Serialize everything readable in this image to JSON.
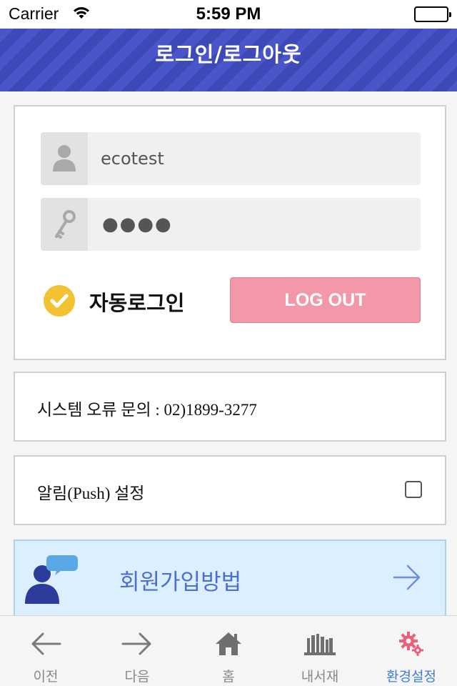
{
  "status_bar": {
    "carrier": "Carrier",
    "time": "5:59 PM"
  },
  "header": {
    "title": "로그인/로그아웃"
  },
  "login": {
    "username_value": "ecotest",
    "password_masked": "●●●●",
    "auto_login_label": "자동로그인",
    "auto_login_checked": true,
    "logout_label": "LOG OUT"
  },
  "contact": {
    "text": "시스템 오류 문의 :  02)1899-3277"
  },
  "push": {
    "label": "알림(Push) 설정",
    "checked": false
  },
  "join": {
    "label": "회원가입방법"
  },
  "tabs": [
    {
      "label": "이전",
      "icon": "arrow-left-icon"
    },
    {
      "label": "다음",
      "icon": "arrow-right-icon"
    },
    {
      "label": "홈",
      "icon": "home-icon"
    },
    {
      "label": "내서재",
      "icon": "bookshelf-icon"
    },
    {
      "label": "환경설정",
      "icon": "gear-icon",
      "active": true
    }
  ],
  "colors": {
    "header": "#4a55c9",
    "logout_button": "#f398a8",
    "check": "#f2c230",
    "join_banner": "#dbefff",
    "active_tab": "#3b7fd8"
  }
}
